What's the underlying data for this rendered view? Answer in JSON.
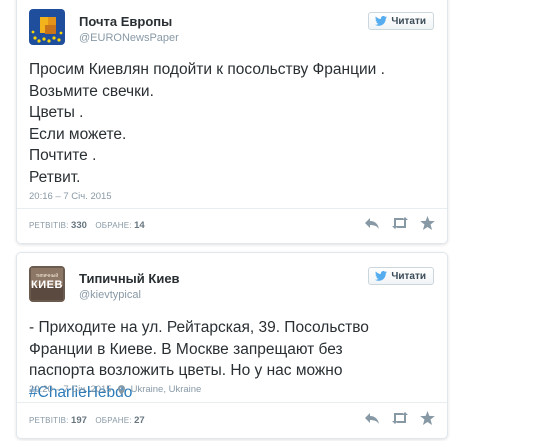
{
  "tweets": [
    {
      "author_name": "Почта Европы",
      "author_handle": "@EURONewsPaper",
      "follow_label": "Читати",
      "text_lines": [
        "Просим Киевлян подойти к посольству Франции .",
        "Возьмите свечки.",
        "Цветы .",
        "Если можете.",
        "Почтите .",
        "Ретвит."
      ],
      "timestamp": "20:16 – 7 Січ. 2015",
      "retweets_label": "РЕТВІТІВ:",
      "retweets_count": "330",
      "favorites_label": "ОБРАНЕ:",
      "favorites_count": "14",
      "avatar_icon": "europe-stars-logo"
    },
    {
      "author_name": "Типичный Киев",
      "author_handle": "@kievtypical",
      "follow_label": "Читати",
      "text_before": "- Приходите на ул. Рейтарская, 39. Посольство Франции в Киеве. В Москве запрещают без паспорта возложить цветы. Но у нас можно ",
      "hashtag": "#CharlieHebdo",
      "timestamp": "20:20 – 7 Січ. 2015",
      "location": "Ukraine, Ukraine",
      "retweets_label": "РЕТВІТІВ:",
      "retweets_count": "197",
      "favorites_label": "ОБРАНЕ:",
      "favorites_count": "27",
      "avatar_text": "КИЕВ",
      "avatar_small_text": "типичный"
    }
  ],
  "colors": {
    "link": "#2b7bb9",
    "twitter_blue": "#55acee",
    "muted": "#8899a6"
  }
}
